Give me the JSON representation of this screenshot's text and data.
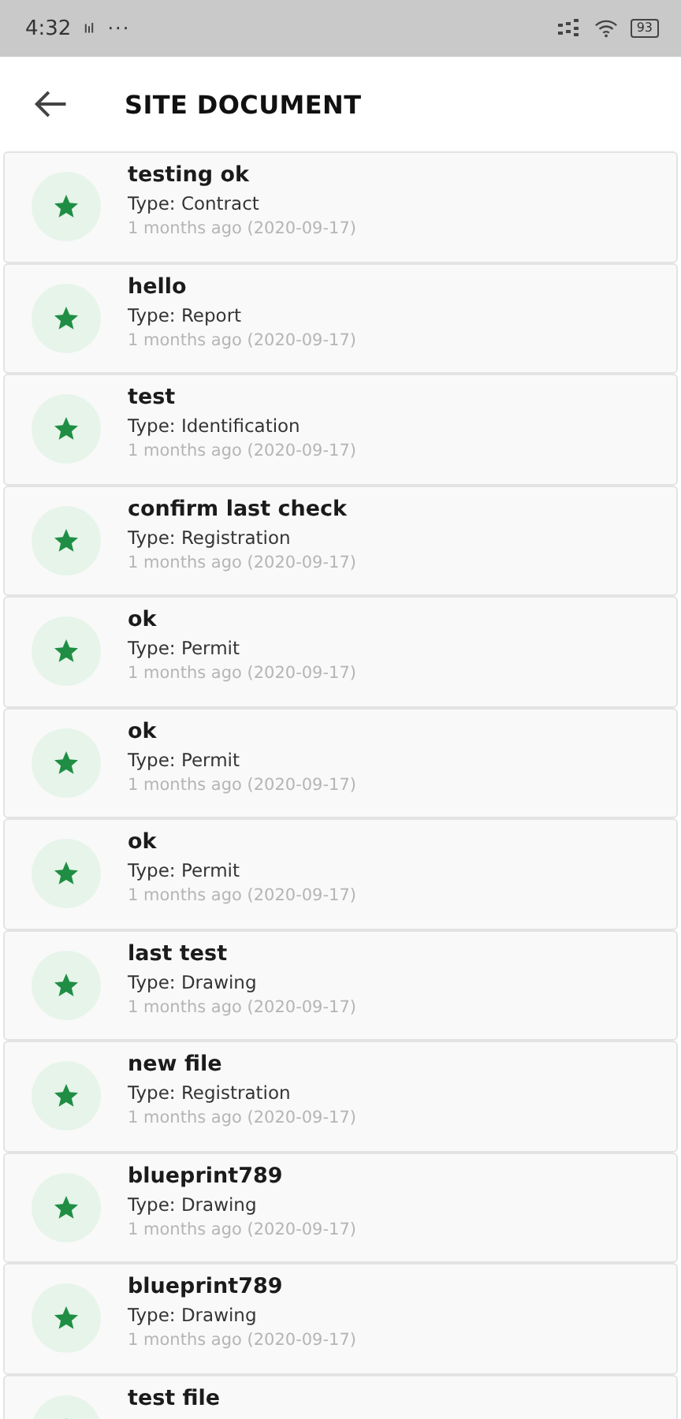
{
  "status_bar": {
    "time": "4:32",
    "more": "···",
    "battery": "93"
  },
  "header": {
    "title": "SITE DOCUMENT"
  },
  "documents": [
    {
      "title": "testing ok",
      "type": "Type: Contract",
      "date": "1 months ago (2020-09-17)"
    },
    {
      "title": "hello",
      "type": "Type: Report",
      "date": "1 months ago (2020-09-17)"
    },
    {
      "title": "test",
      "type": "Type: Identification",
      "date": "1 months ago (2020-09-17)"
    },
    {
      "title": "confirm last check",
      "type": "Type: Registration",
      "date": "1 months ago (2020-09-17)"
    },
    {
      "title": "ok",
      "type": "Type: Permit",
      "date": "1 months ago (2020-09-17)"
    },
    {
      "title": "ok",
      "type": "Type: Permit",
      "date": "1 months ago (2020-09-17)"
    },
    {
      "title": "ok",
      "type": "Type: Permit",
      "date": "1 months ago (2020-09-17)"
    },
    {
      "title": "last test",
      "type": "Type: Drawing",
      "date": "1 months ago (2020-09-17)"
    },
    {
      "title": "new file",
      "type": "Type: Registration",
      "date": "1 months ago (2020-09-17)"
    },
    {
      "title": "blueprint789",
      "type": "Type: Drawing",
      "date": "1 months ago (2020-09-17)"
    },
    {
      "title": "blueprint789",
      "type": "Type: Drawing",
      "date": "1 months ago (2020-09-17)"
    },
    {
      "title": "test file"
    }
  ]
}
